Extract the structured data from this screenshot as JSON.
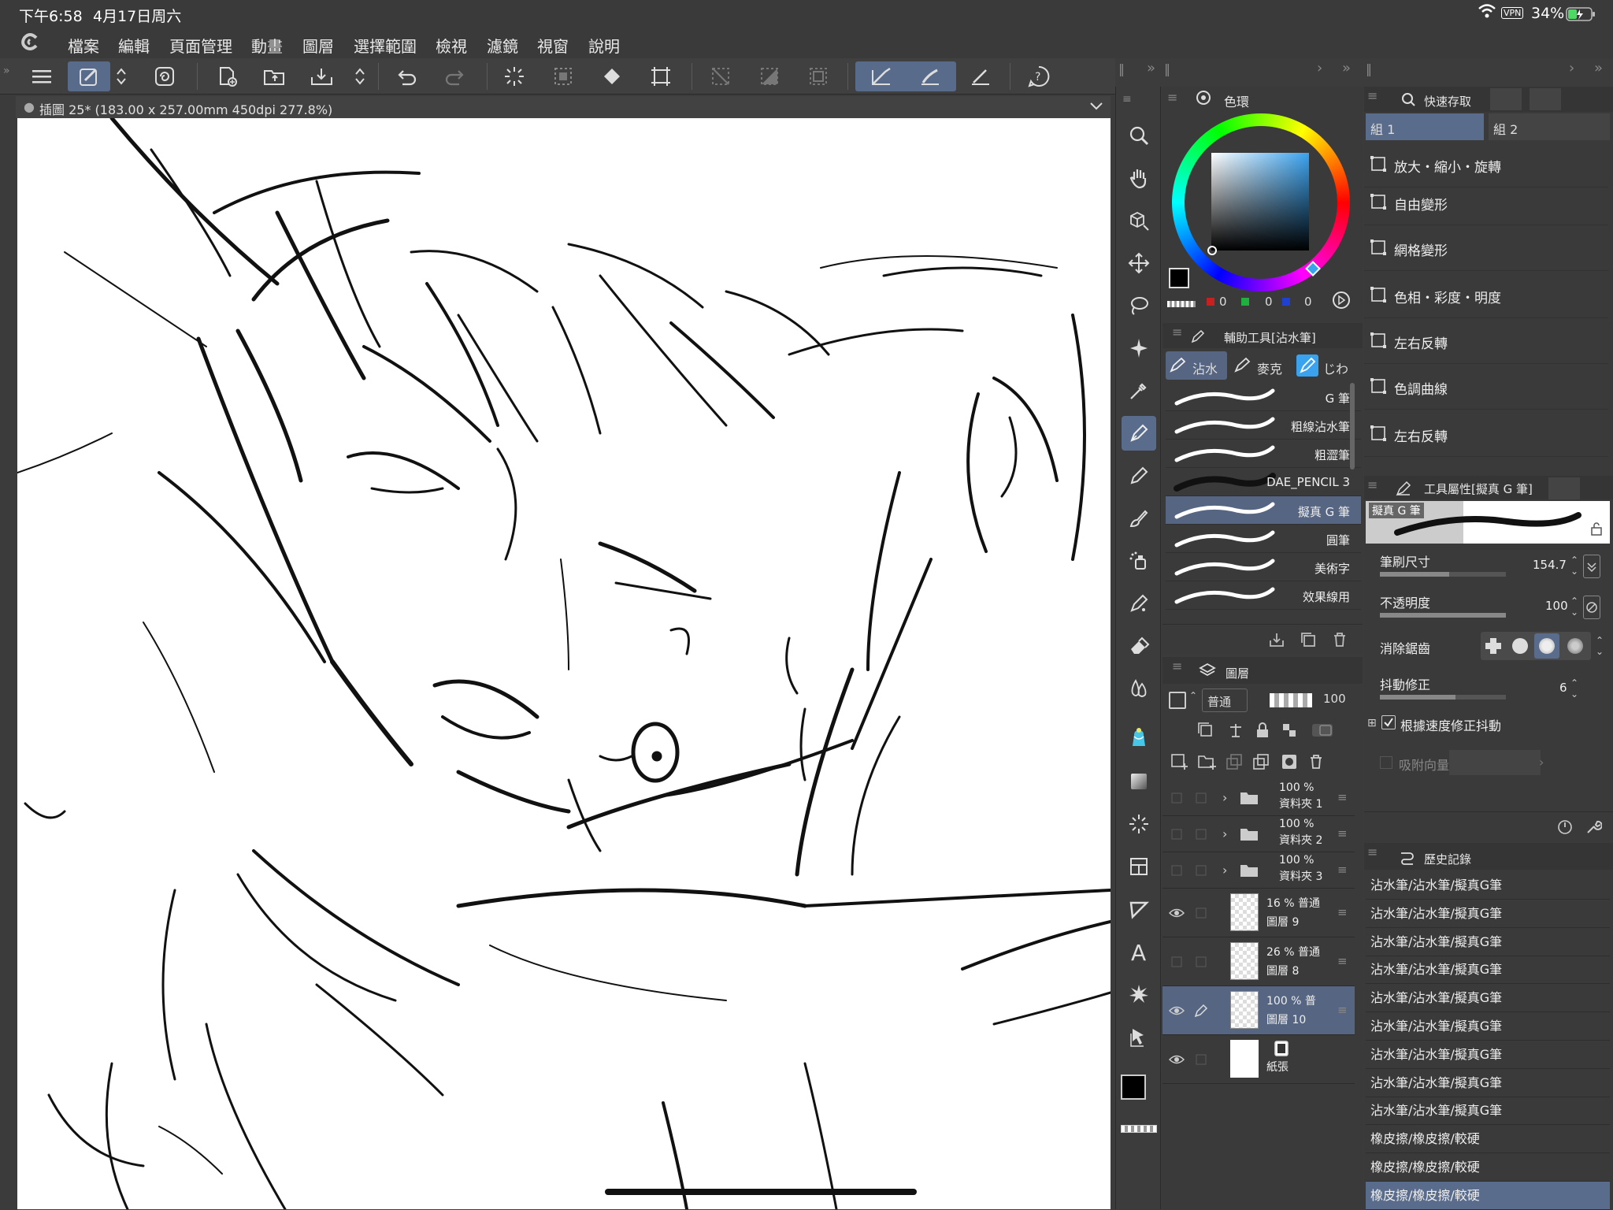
{
  "status_bar": {
    "time": "下午6:58",
    "date": "4月17日周六",
    "vpn": "VPN",
    "battery": "34%"
  },
  "menu": [
    "檔案",
    "編輯",
    "頁面管理",
    "動畫",
    "圖層",
    "選擇範圍",
    "檢視",
    "濾鏡",
    "視窗",
    "說明"
  ],
  "document": {
    "tab_label": "插圖 25* (183.00 x 257.00mm 450dpi 277.8%)"
  },
  "color_wheel": {
    "title": "色環",
    "r": "0",
    "g": "0",
    "b": "0",
    "main_color": "#000000",
    "sub_color": "#5a10d8"
  },
  "sub_tool": {
    "title": "輔助工具[沾水筆]",
    "tabs": [
      "沾水",
      "麥克",
      "じわ"
    ],
    "brushes": [
      {
        "name": "G 筆",
        "selected": false
      },
      {
        "name": "粗線沾水筆",
        "selected": false
      },
      {
        "name": "粗澀筆",
        "selected": false
      },
      {
        "name": "DAE_PENCIL 3",
        "selected": false
      },
      {
        "name": "擬真 G 筆",
        "selected": true
      },
      {
        "name": "圓筆",
        "selected": false
      },
      {
        "name": "美術字",
        "selected": false
      },
      {
        "name": "效果線用",
        "selected": false
      }
    ]
  },
  "layers": {
    "title": "圖層",
    "blend_mode": "普通",
    "opacity": "100",
    "items": [
      {
        "opacity": "100 %",
        "name": "資料夾 1",
        "type": "folder",
        "visible": false,
        "selected": false
      },
      {
        "opacity": "100 %",
        "name": "資料夾 2",
        "type": "folder",
        "visible": false,
        "selected": false
      },
      {
        "opacity": "100 %",
        "name": "資料夾 3",
        "type": "folder",
        "visible": false,
        "selected": false
      },
      {
        "opacity": "16 % 普通",
        "name": "圖層 9",
        "type": "raster",
        "visible": true,
        "selected": false
      },
      {
        "opacity": "26 % 普通",
        "name": "圖層 8",
        "type": "raster",
        "visible": false,
        "selected": false
      },
      {
        "opacity": "100 % 普",
        "name": "圖層 10",
        "type": "raster",
        "visible": true,
        "selected": true
      },
      {
        "opacity": "",
        "name": "紙張",
        "type": "paper",
        "visible": true,
        "selected": false
      }
    ]
  },
  "quick_access": {
    "title": "快速存取",
    "tabs": [
      "組 1",
      "組 2"
    ],
    "items": [
      "放大・縮小・旋轉",
      "自由變形",
      "網格變形",
      "色相・彩度・明度",
      "左右反轉",
      "色調曲線",
      "左右反轉"
    ]
  },
  "tool_property": {
    "title": "工具屬性[擬真 G 筆]",
    "preview_label": "擬真 G 筆",
    "brush_size_label": "筆刷尺寸",
    "brush_size": "154.7",
    "brush_size_level": 0.55,
    "opacity_label": "不透明度",
    "opacity": "100",
    "opacity_level": 1.0,
    "antialias_label": "消除鋸齒",
    "stabilization_label": "抖動修正",
    "stabilization": "6",
    "stabilization_level": 0.6,
    "speed_label": "根據速度修正抖動",
    "snap_label": "吸附向量"
  },
  "history": {
    "title": "歷史記錄",
    "items": [
      "沾水筆/沾水筆/擬真G筆",
      "沾水筆/沾水筆/擬真G筆",
      "沾水筆/沾水筆/擬真G筆",
      "沾水筆/沾水筆/擬真G筆",
      "沾水筆/沾水筆/擬真G筆",
      "沾水筆/沾水筆/擬真G筆",
      "沾水筆/沾水筆/擬真G筆",
      "沾水筆/沾水筆/擬真G筆",
      "沾水筆/沾水筆/擬真G筆",
      "橡皮擦/橡皮擦/較硬",
      "橡皮擦/橡皮擦/較硬",
      "橡皮擦/橡皮擦/較硬"
    ]
  },
  "colors": {
    "accent": "#5a6c8c",
    "selected_row": "#556582",
    "panel_bg": "#3a3a3a",
    "canvas_bg": "#ffffff"
  },
  "icons": {
    "toolbox": [
      "zoom-icon",
      "hand-icon",
      "move-3d-icon",
      "move-layer-icon",
      "lasso-icon",
      "auto-select-icon",
      "eyedropper-icon",
      "pen-icon",
      "pencil-icon",
      "brush-icon",
      "airbrush-icon",
      "decoration-icon",
      "eraser-icon",
      "blend-icon",
      "fill-icon",
      "gradient-icon",
      "figure-icon",
      "frame-icon",
      "balloon-icon",
      "text-icon",
      "sparkle-icon",
      "correct-line-icon"
    ]
  }
}
